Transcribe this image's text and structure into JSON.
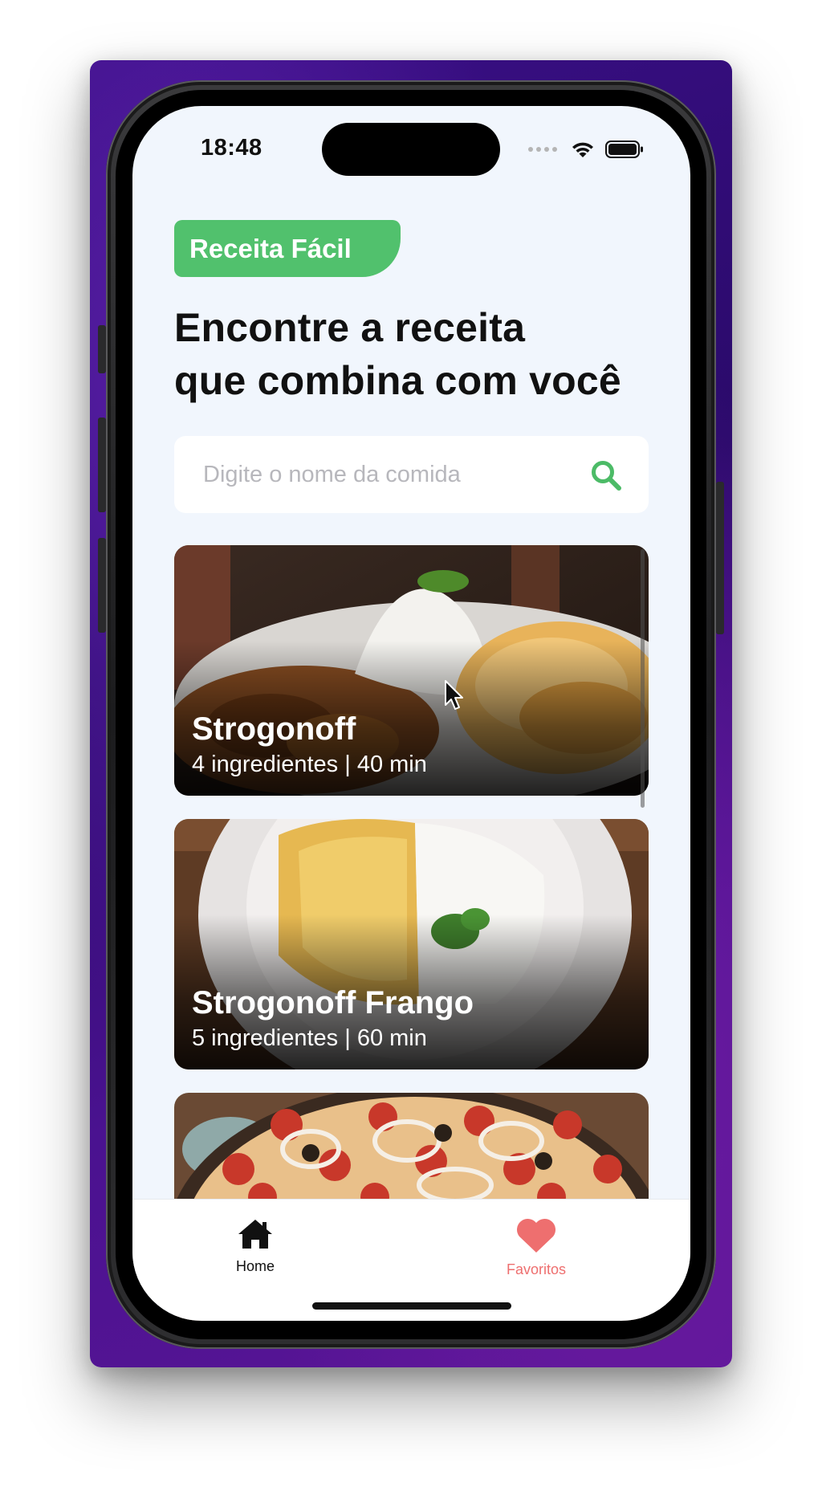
{
  "status_bar": {
    "time": "18:48"
  },
  "header": {
    "brand_label": "Receita Fácil",
    "headline_line1": "Encontre a receita",
    "headline_line2": "que combina com você"
  },
  "search": {
    "placeholder": "Digite o nome da comida",
    "value": ""
  },
  "recipes": [
    {
      "title": "Strogonoff",
      "meta": "4 ingredientes | 40 min"
    },
    {
      "title": "Strogonoff Frango",
      "meta": "5 ingredientes | 60 min"
    },
    {
      "title": "",
      "meta": ""
    }
  ],
  "tabs": {
    "home_label": "Home",
    "favorites_label": "Favoritos"
  },
  "colors": {
    "brand_green": "#51c16d",
    "favorites_red": "#ee6f6f",
    "screen_background": "#f1f6fd"
  },
  "icons": [
    "search-icon",
    "home-icon",
    "heart-icon",
    "wifi-icon",
    "battery-icon",
    "signal-icon"
  ]
}
